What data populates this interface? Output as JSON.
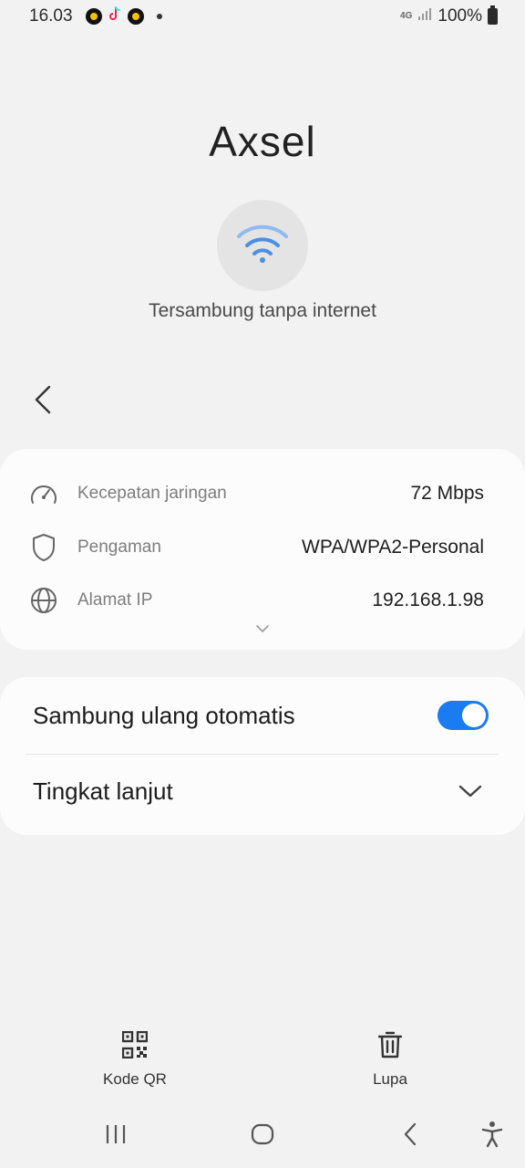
{
  "status_bar": {
    "time": "16.03",
    "network": "4G",
    "battery": "100%"
  },
  "network": {
    "name": "Axsel",
    "status": "Tersambung tanpa internet"
  },
  "details": {
    "rows": [
      {
        "icon": "speedometer-icon",
        "label": "Kecepatan jaringan",
        "value": "72 Mbps"
      },
      {
        "icon": "shield-icon",
        "label": "Pengaman",
        "value": "WPA/WPA2-Personal"
      },
      {
        "icon": "globe-icon",
        "label": "Alamat IP",
        "value": "192.168.1.98"
      }
    ]
  },
  "settings": {
    "auto_reconnect_label": "Sambung ulang otomatis",
    "auto_reconnect_on": true,
    "advanced_label": "Tingkat lanjut"
  },
  "actions": {
    "qr_label": "Kode QR",
    "forget_label": "Lupa"
  },
  "colors": {
    "accent": "#1a7cf0",
    "wifi_icon": "#4a90e2",
    "background": "#f2f2f2",
    "card": "#fcfcfc"
  }
}
